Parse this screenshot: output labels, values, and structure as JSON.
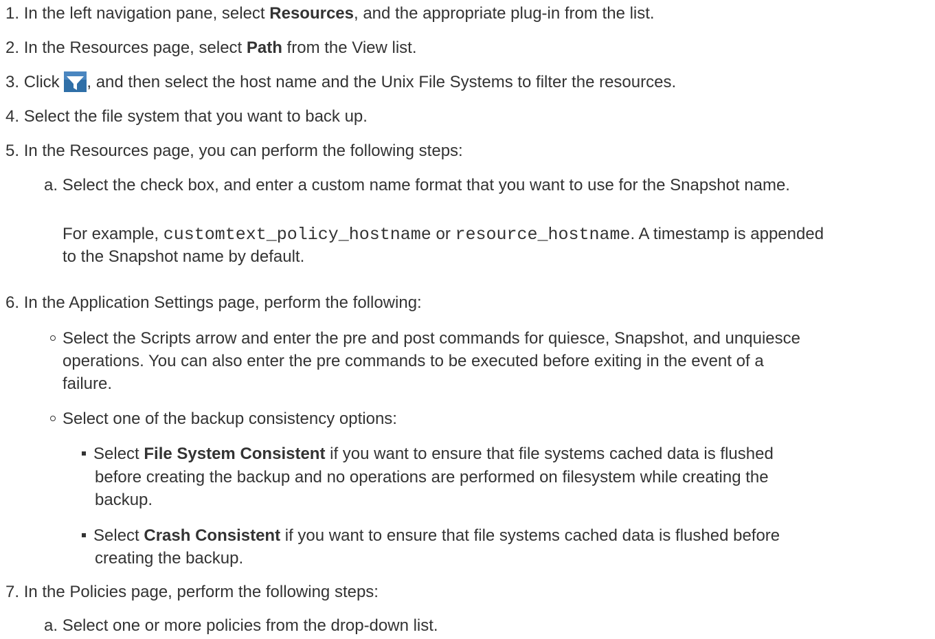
{
  "step1": {
    "num": "1.",
    "pre": "In the left navigation pane, select ",
    "bold": "Resources",
    "post": ", and the appropriate plug-in from the list."
  },
  "step2": {
    "num": "2.",
    "pre": "In the Resources page, select ",
    "bold": "Path",
    "post": " from the View list."
  },
  "step3": {
    "num": "3.",
    "pre": "Click ",
    "icon": "filter-icon",
    "post": ", and then select the host name and the Unix File Systems to filter the resources."
  },
  "step4": {
    "num": "4.",
    "text": "Select the file system that you want to back up."
  },
  "step5": {
    "num": "5.",
    "text": "In the Resources page, you can perform the following steps:",
    "sub_a": {
      "letter": "a.",
      "text": "Select the check box, and enter a custom name format that you want to use for the Snapshot name."
    },
    "example": {
      "pre": "For example, ",
      "code1": "customtext_policy_hostname",
      "mid": " or ",
      "code2": "resource_hostname",
      "post": ". A timestamp is appended",
      "line2": "to the Snapshot name by default."
    }
  },
  "step6": {
    "num": "6.",
    "text": "In the Application Settings page, perform the following:",
    "bullet1": {
      "line1": "Select the Scripts arrow and enter the pre and post commands for quiesce, Snapshot, and unquiesce",
      "line2": "operations. You can also enter the pre commands to be executed before exiting in the event of a",
      "line3": "failure."
    },
    "bullet2": {
      "text": "Select one of the backup consistency options:"
    },
    "opt1": {
      "pre": "Select ",
      "bold": "File System Consistent",
      "post": " if you want to ensure that file systems cached data is flushed",
      "line2": "before creating the backup and no operations are performed on filesystem while creating the",
      "line3": "backup."
    },
    "opt2": {
      "pre": "Select ",
      "bold": "Crash Consistent",
      "post": " if you want to ensure that file systems cached data is flushed before",
      "line2": "creating the backup."
    }
  },
  "step7": {
    "num": "7.",
    "text": "In the Policies page, perform the following steps:",
    "sub_a": {
      "letter": "a.",
      "text": "Select one or more policies from the drop-down list."
    }
  },
  "colors": {
    "text": "#333333",
    "icon_bg": "#2f6fa7"
  }
}
